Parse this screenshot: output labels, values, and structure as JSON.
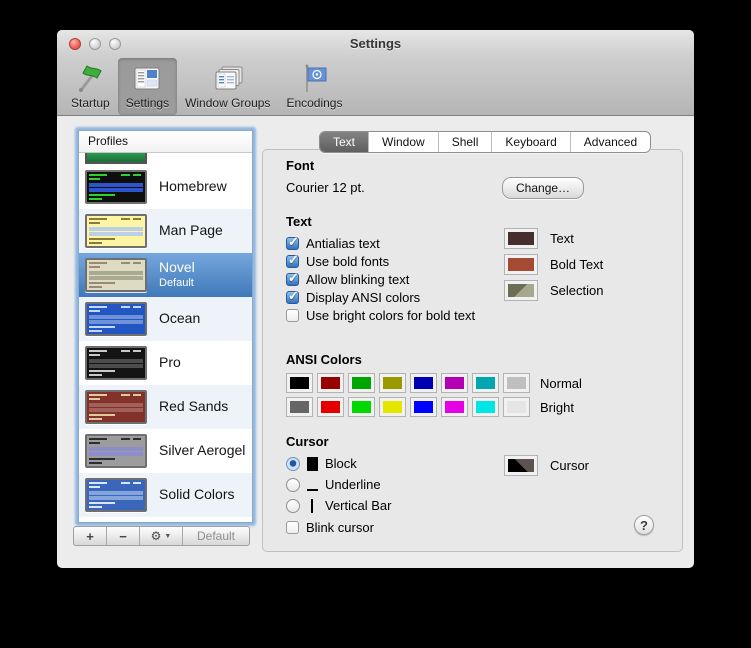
{
  "window": {
    "title": "Settings"
  },
  "toolbar": {
    "items": [
      {
        "label": "Startup",
        "selected": false
      },
      {
        "label": "Settings",
        "selected": true
      },
      {
        "label": "Window Groups",
        "selected": false
      },
      {
        "label": "Encodings",
        "selected": false
      }
    ]
  },
  "sidebar": {
    "header": "Profiles",
    "profiles": [
      {
        "name": "Homebrew",
        "subtitle": "",
        "selected": false,
        "thumb": {
          "bg": "#0e0e0e",
          "fg": "#2bd32b",
          "sel": "#2d55cf"
        }
      },
      {
        "name": "Man Page",
        "subtitle": "",
        "selected": false,
        "thumb": {
          "bg": "#fdf4a4",
          "fg": "#8a7a40",
          "sel": "#bccfe9"
        }
      },
      {
        "name": "Novel",
        "subtitle": "Default",
        "selected": true,
        "thumb": {
          "bg": "#dedbc2",
          "fg": "#9a8a74",
          "sel": "#a9ab90"
        }
      },
      {
        "name": "Ocean",
        "subtitle": "",
        "selected": false,
        "thumb": {
          "bg": "#2256c2",
          "fg": "#c3d6f5",
          "sel": "#6f91da"
        }
      },
      {
        "name": "Pro",
        "subtitle": "",
        "selected": false,
        "thumb": {
          "bg": "#141414",
          "fg": "#c9c9c9",
          "sel": "#4c4c4c"
        }
      },
      {
        "name": "Red Sands",
        "subtitle": "",
        "selected": false,
        "thumb": {
          "bg": "#82322a",
          "fg": "#ddca9e",
          "sel": "#a2605a"
        }
      },
      {
        "name": "Silver Aerogel",
        "subtitle": "",
        "selected": false,
        "thumb": {
          "bg": "#9c9c9c",
          "fg": "#2e2e2e",
          "sel": "#8d8dcb"
        }
      },
      {
        "name": "Solid Colors",
        "subtitle": "",
        "selected": false,
        "thumb": {
          "bg": "#3a66bb",
          "fg": "#d9e5f8",
          "sel": "#87a5dd"
        }
      }
    ],
    "actions": {
      "add": "+",
      "remove": "−",
      "gear": "⚙",
      "dropdown": "▼",
      "default_label": "Default"
    }
  },
  "tabs": {
    "items": [
      "Text",
      "Window",
      "Shell",
      "Keyboard",
      "Advanced"
    ],
    "selected": "Text"
  },
  "panel": {
    "font": {
      "header": "Font",
      "value": "Courier 12 pt.",
      "change_label": "Change…"
    },
    "text": {
      "header": "Text",
      "checkboxes": [
        {
          "label": "Antialias text",
          "checked": true
        },
        {
          "label": "Use bold fonts",
          "checked": true
        },
        {
          "label": "Allow blinking text",
          "checked": true
        },
        {
          "label": "Display ANSI colors",
          "checked": true
        },
        {
          "label": "Use bright colors for bold text",
          "checked": false
        }
      ],
      "wells": [
        {
          "label": "Text",
          "colors": [
            "#452e2e"
          ],
          "angle": 135
        },
        {
          "label": "Bold Text",
          "colors": [
            "#a54a33"
          ],
          "angle": 135
        },
        {
          "label": "Selection",
          "colors": [
            "#6b6e54",
            "#a5a78f"
          ],
          "angle": 135
        }
      ]
    },
    "ansi": {
      "header": "ANSI Colors",
      "rows": [
        {
          "label": "Normal",
          "colors": [
            "#000000",
            "#990000",
            "#00a600",
            "#999900",
            "#0000b2",
            "#b200b2",
            "#00a6b2",
            "#bfbfbf"
          ]
        },
        {
          "label": "Bright",
          "colors": [
            "#666666",
            "#e50000",
            "#00d900",
            "#e5e500",
            "#0000ff",
            "#e500e5",
            "#00e5e5",
            "#e5e5e5"
          ]
        }
      ]
    },
    "cursor": {
      "header": "Cursor",
      "radios": [
        {
          "label": "Block",
          "glyph": "block",
          "selected": true
        },
        {
          "label": "Underline",
          "glyph": "underline",
          "selected": false
        },
        {
          "label": "Vertical Bar",
          "glyph": "vbar",
          "selected": false
        }
      ],
      "blink": {
        "label": "Blink cursor",
        "checked": false
      },
      "well": {
        "label": "Cursor",
        "colors": [
          "#000000",
          "#5d524f"
        ],
        "angle": 45
      }
    },
    "help_label": "?"
  }
}
